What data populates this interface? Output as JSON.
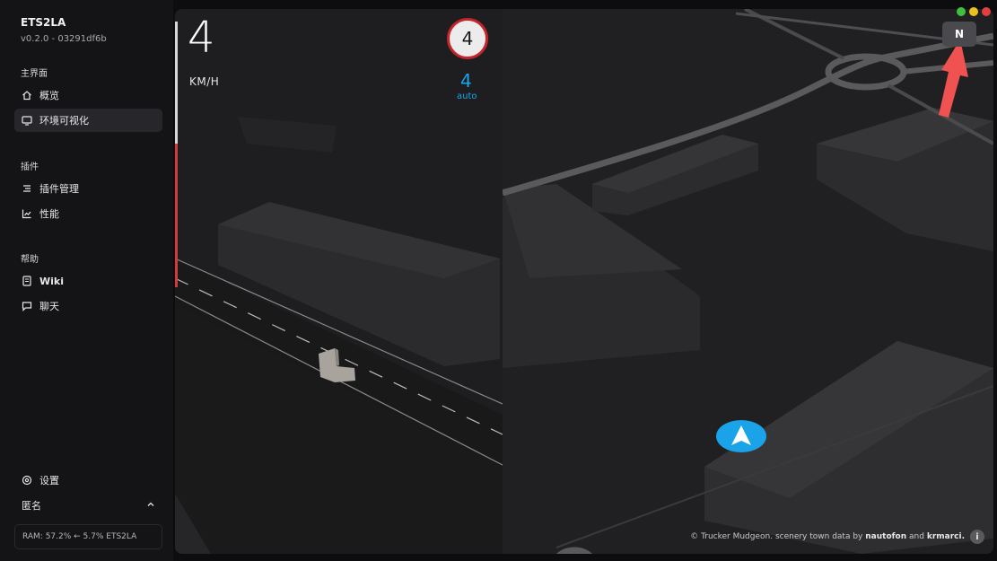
{
  "app": {
    "name": "ETS2LA",
    "version": "v0.2.0 - 03291df6b"
  },
  "sidebar": {
    "sections": [
      {
        "label": "主界面",
        "items": [
          {
            "label": "概览",
            "icon": "home-icon"
          },
          {
            "label": "环境可视化",
            "icon": "monitor-icon",
            "active": true
          }
        ]
      },
      {
        "label": "插件",
        "items": [
          {
            "label": "插件管理",
            "icon": "list-icon"
          },
          {
            "label": "性能",
            "icon": "chart-icon"
          }
        ]
      },
      {
        "label": "帮助",
        "items": [
          {
            "label": "Wiki",
            "icon": "book-icon"
          },
          {
            "label": "聊天",
            "icon": "chat-icon"
          }
        ]
      }
    ],
    "settings_label": "设置",
    "user_label": "匿名",
    "ram_status": "RAM: 57.2% ← 5.7% ETS2LA"
  },
  "hud": {
    "speed": "4",
    "speed_unit": "KM/H",
    "speed_limit": "4",
    "target_speed": "4",
    "target_mode": "auto"
  },
  "map": {
    "compass_label": "N",
    "attribution_prefix": "© Trucker Mudgeon. scenery town data by",
    "attribution_author1": "nautofon",
    "attribution_and": "and",
    "attribution_author2": "krmarci.",
    "info_label": "i"
  },
  "colors": {
    "accent_blue": "#1aa3e8",
    "limit_red": "#c2252b",
    "arrow_red": "#f05252",
    "dot_green": "#3fbf3f",
    "dot_yellow": "#e8c020",
    "dot_red": "#e04040"
  }
}
